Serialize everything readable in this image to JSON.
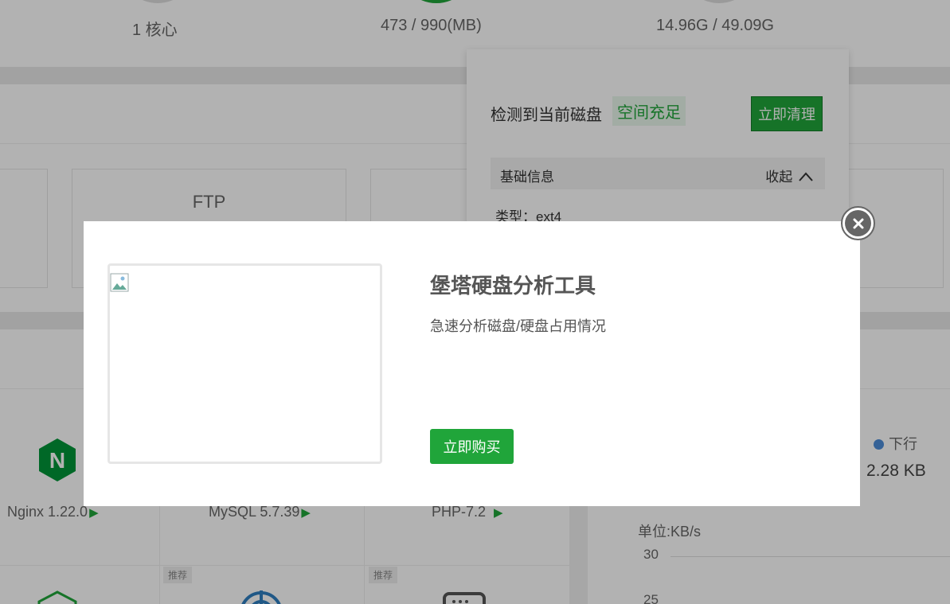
{
  "stats": {
    "cpu": "1 核心",
    "memory": "473 / 990(MB)",
    "disk": "14.96G / 49.09G"
  },
  "cards": {
    "ftp": "FTP"
  },
  "disk_popover": {
    "detect_text": "检测到当前磁盘",
    "status": "空间充足",
    "clean_button": "立即清理",
    "section_title": "基础信息",
    "collapse_label": "收起",
    "type_text": "类型：ext4"
  },
  "software": {
    "items": [
      {
        "name": "Nginx 1.22.0"
      },
      {
        "name": "MySQL 5.7.39"
      },
      {
        "name": "PHP-7.2"
      }
    ],
    "recommend_tag": "推荐"
  },
  "network": {
    "downstream_label": "下行",
    "downstream_value": "2.28 KB",
    "unit_label": "单位:KB/s",
    "ticks": [
      "30",
      "25"
    ]
  },
  "modal": {
    "title": "堡塔硬盘分析工具",
    "description": "急速分析磁盘/硬盘占用情况",
    "buy_button": "立即购买"
  },
  "colors": {
    "accent": "#20a53a",
    "downstream": "#4d8dd8"
  },
  "icons": {
    "close": "close-icon",
    "nginx": "nginx-logo-icon",
    "broken_image": "broken-image-icon"
  }
}
